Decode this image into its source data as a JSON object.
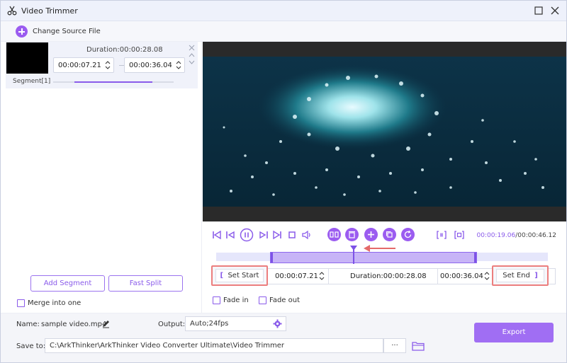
{
  "window": {
    "title": "Video Trimmer"
  },
  "toolbar": {
    "change_source_label": "Change Source File"
  },
  "segment": {
    "duration": "Duration:00:00:28.08",
    "start": "00:00:07.21",
    "end": "00:00:36.04",
    "label": "Segment[1]",
    "progress": 0.76
  },
  "left_actions": {
    "add_segment": "Add Segment",
    "fast_split": "Fast Split",
    "merge_label": "Merge into one"
  },
  "player": {
    "current_time": "00:00:19.06",
    "total_time": "/00:00:46.12"
  },
  "trim": {
    "set_start": "Set Start",
    "start_time": "00:00:07.21",
    "duration": "Duration:00:00:28.08",
    "end_time": "00:00:36.04",
    "set_end": "Set End",
    "fade_in": "Fade in",
    "fade_out": "Fade out"
  },
  "output": {
    "name_label": "Name:",
    "name_value": "sample video.mp4",
    "output_label": "Output:",
    "output_value": "Auto;24fps",
    "save_label": "Save to:",
    "save_path": "C:\\ArkThinker\\ArkThinker Video Converter Ultimate\\Video Trimmer",
    "browse": "···",
    "export": "Export"
  },
  "colors": {
    "accent": "#9b5cf0",
    "highlight": "#ec7e7e"
  }
}
